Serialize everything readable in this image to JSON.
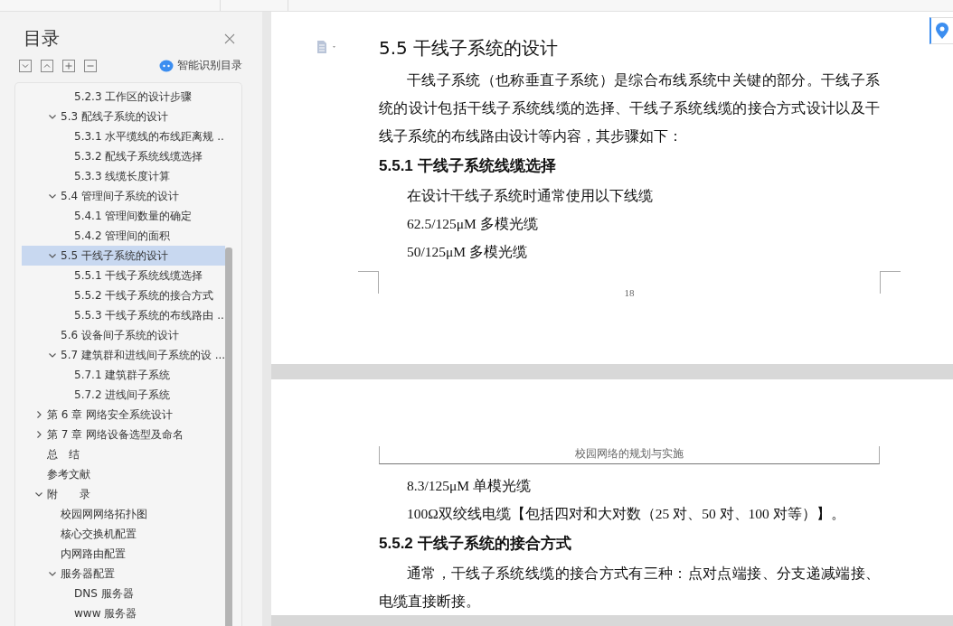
{
  "sidebar": {
    "title": "目录",
    "smart_toc_label": "智能识别目录",
    "items": [
      {
        "children": [
          {
            "children": [
              {
                "label": "5.2.3 工作区的设计步骤",
                "selected": false
              }
            ]
          },
          {
            "label": "5.3 配线子系统的设计",
            "selected": false,
            "expanded": true,
            "children": [
              {
                "label": "5.3.1 水平缆线的布线距离规 ...",
                "selected": false
              },
              {
                "label": "5.3.2 配线子系统线缆选择",
                "selected": false
              },
              {
                "label": "5.3.3 线缆长度计算",
                "selected": false
              }
            ]
          },
          {
            "label": "5.4 管理间子系统的设计",
            "selected": false,
            "expanded": true,
            "children": [
              {
                "label": "5.4.1 管理间数量的确定",
                "selected": false
              },
              {
                "label": "5.4.2 管理间的面积",
                "selected": false
              }
            ]
          },
          {
            "label": "5.5 干线子系统的设计",
            "selected": true,
            "expanded": true,
            "children": [
              {
                "label": "5.5.1 干线子系统线缆选择",
                "selected": false
              },
              {
                "label": "5.5.2 干线子系统的接合方式",
                "selected": false
              },
              {
                "label": "5.5.3 干线子系统的布线路由 ...",
                "selected": false
              }
            ]
          },
          {
            "label": "5.6 设备间子系统的设计",
            "selected": false
          },
          {
            "label": "5.7 建筑群和进线间子系统的设 ...",
            "selected": false,
            "expanded": true,
            "children": [
              {
                "label": "5.7.1 建筑群子系统",
                "selected": false
              },
              {
                "label": "5.7.2 进线间子系统",
                "selected": false
              }
            ]
          }
        ]
      },
      {
        "label": "第 6 章  网络安全系统设计",
        "selected": false,
        "expanded": false
      },
      {
        "label": "第 7 章  网络设备选型及命名",
        "selected": false,
        "expanded": false
      },
      {
        "label": "总　结",
        "selected": false
      },
      {
        "label": "参考文献",
        "selected": false
      },
      {
        "label": "附　　录",
        "selected": false,
        "expanded": true,
        "children": [
          {
            "label": "校园网网络拓扑图",
            "selected": false
          },
          {
            "label": "核心交换机配置",
            "selected": false
          },
          {
            "label": "内网路由配置",
            "selected": false
          },
          {
            "label": "服务器配置",
            "selected": false,
            "expanded": true,
            "children": [
              {
                "label": "DNS 服务器",
                "selected": false
              },
              {
                "label": "www 服务器",
                "selected": false
              }
            ]
          }
        ]
      }
    ]
  },
  "document": {
    "pages": [
      {
        "blocks": [
          {
            "kind": "heading2",
            "text": "5.5 干线子系统的设计"
          },
          {
            "kind": "paragraph",
            "text": "干线子系统（也称垂直子系统）是综合布线系统中关键的部分。干线子系统的设计包括干线子系统线缆的选择、干线子系统线缆的接合方式设计以及干线子系统的布线路由设计等内容，其步骤如下："
          },
          {
            "kind": "heading3",
            "text": "5.5.1 干线子系统线缆选择"
          },
          {
            "kind": "paragraph",
            "text": "在设计干线子系统时通常使用以下线缆"
          },
          {
            "kind": "paragraph",
            "text": "62.5/125μM 多模光缆"
          },
          {
            "kind": "paragraph",
            "text": "50/125μM 多模光缆"
          }
        ],
        "page_number": "18"
      },
      {
        "header": "校园网络的规划与实施",
        "blocks": [
          {
            "kind": "paragraph",
            "text": "8.3/125μM 单模光缆"
          },
          {
            "kind": "paragraph",
            "text": "100Ω双绞线电缆【包括四对和大对数（25 对、50 对、100 对等）】。"
          },
          {
            "kind": "heading3",
            "text": "5.5.2 干线子系统的接合方式"
          },
          {
            "kind": "paragraph",
            "text": "通常，干线子系统线缆的接合方式有三种：点对点端接、分支递减端接、电缆直接断接。"
          }
        ]
      }
    ]
  }
}
